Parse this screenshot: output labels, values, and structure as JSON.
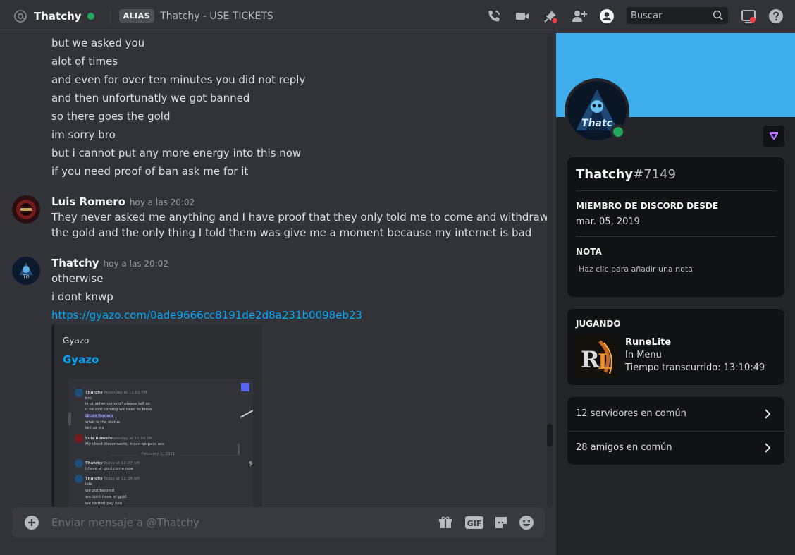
{
  "header": {
    "title": "Thatchy",
    "alias_badge": "ALIAS",
    "alias_text": "Thatchy - USE TICKETS",
    "search_placeholder": "Buscar"
  },
  "messages": {
    "continued_lines": [
      "but we asked you",
      "alot of times",
      "and even for over ten minutes you did not reply",
      "and then unfortunatly we got banned",
      "so there goes the gold",
      "im sorry bro",
      "but i cannot put any more energy into this now",
      "if you need proof of ban ask me for it"
    ],
    "group1": {
      "author": "Luis Romero",
      "time": "hoy a las 20:02",
      "lines": [
        "They never asked me anything and I have proof that they only told me to come and withdraw",
        "the gold and the only thing I told them was give me a moment because my internet is bad"
      ]
    },
    "group2": {
      "author": "Thatchy",
      "time": "hoy a las 20:02",
      "lines": [
        "otherwise",
        "i dont knwp"
      ],
      "link": "https://gyazo.com/0ade9666cc8191de2d8a231b0098eb23"
    },
    "embed": {
      "provider": "Gyazo",
      "title": "Gyazo",
      "preview": {
        "l1": "Thatchy",
        "l1t": "Yesterday at 11:53 PM",
        "l2": "bro",
        "l3": "is ur seller coming? please tell us",
        "l4": "if he aint coming we need to know",
        "l5": "@Luis Romero",
        "l6": "what is the status",
        "l7": "tell us pls",
        "l8": "Luis Romero",
        "l8t": "Yesterday at 11:56 PM",
        "l9": "My client disconnects, it can be pass acc",
        "l10": "February 1, 2021",
        "l11": "Thatchy",
        "l11t": "Today at 12:27 AM",
        "l12": "I have ur gold come now",
        "l13": "Thatchy",
        "l13t": "Today at 12:34 AM",
        "l14": "lole",
        "l15": "we got banned",
        "l16": "we dont have ur gold",
        "l17": "we cannot pay you",
        "l18": "$"
      }
    }
  },
  "composer": {
    "placeholder": "Enviar mensaje a @Thatchy"
  },
  "profile": {
    "username": "Thatchy",
    "discriminator": "#7149",
    "member_since_title": "MIEMBRO DE DISCORD DESDE",
    "member_since": "mar. 05, 2019",
    "note_title": "NOTA",
    "note_placeholder": "Haz clic para añadir una nota",
    "activity_title": "JUGANDO",
    "game_name": "RuneLite",
    "game_state": "In Menu",
    "game_elapsed": "Tiempo transcurrido: 13:10:49",
    "mutual_servers": "12 servidores en común",
    "mutual_friends": "28 amigos en común"
  },
  "colors": {
    "accent_link": "#00a8fc",
    "online": "#23a55a",
    "banner": "#3daeeb",
    "notify_red": "#f23f43"
  }
}
